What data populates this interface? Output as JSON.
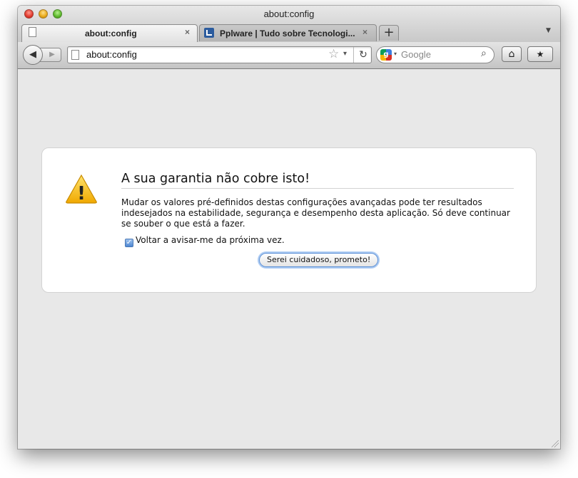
{
  "window": {
    "title": "about:config"
  },
  "tabs": [
    {
      "label": "about:config",
      "active": true
    },
    {
      "label": "Pplware | Tudo sobre Tecnologi...",
      "active": false
    }
  ],
  "tab_close_glyph": "×",
  "new_tab_glyph": "+",
  "tab_list_glyph": "▼",
  "toolbar": {
    "back_glyph": "◀",
    "forward_glyph": "▶",
    "url": "about:config",
    "bookmark_star_glyph": "☆",
    "url_dropdown_glyph": "▾",
    "reload_glyph": "↻",
    "search_engine_letter": "g",
    "search_dropdown_glyph": "▾",
    "search_placeholder": "Google",
    "search_icon_glyph": "⌕",
    "home_glyph": "⌂",
    "bookmarks_glyph": "★"
  },
  "warning": {
    "title": "A sua garantia não cobre isto!",
    "body": "Mudar os valores pré-definidos destas configurações avançadas pode ter resultados indesejados na estabilidade, segurança e desempenho desta aplicação. Só deve continuar se souber o que está a fazer.",
    "checkbox_label": "Voltar a avisar-me da próxima vez.",
    "checkbox_checked": true,
    "checkbox_glyph": "✓",
    "button_label": "Serei cuidadoso, prometo!",
    "icon_mark": "!"
  },
  "colors": {
    "warning_yellow": "#f6c21e",
    "focus_blue": "#5a8fd6"
  }
}
